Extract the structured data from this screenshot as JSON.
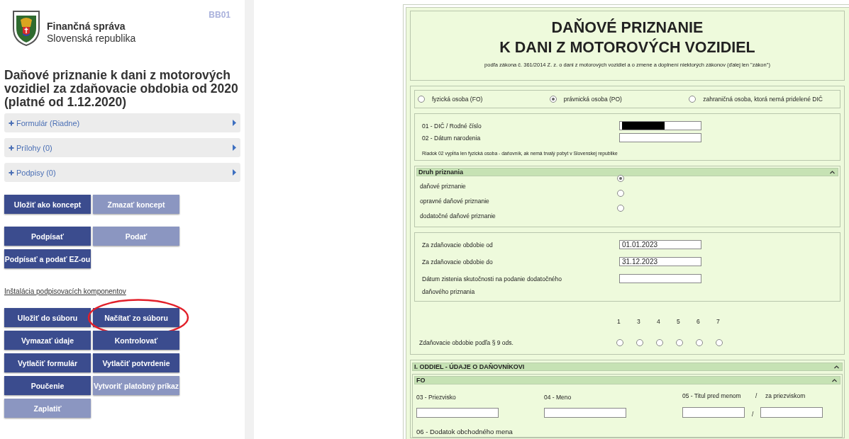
{
  "sidebar": {
    "org_name": "Finančná správa",
    "org_country": "Slovenská republika",
    "code": "BB01",
    "heading": "Daňové priznanie k dani z motorových vozidiel za zdaňovacie obdobia od 2020 (platné od 1.12.2020)",
    "accordions": [
      {
        "label": "Formulár (Riadne)"
      },
      {
        "label": "Prílohy (0)"
      },
      {
        "label": "Podpisy (0)"
      }
    ],
    "button_blocks": [
      {
        "rows": [
          [
            {
              "label": "Uložiť ako koncept",
              "disabled": false,
              "highlighted": false
            },
            {
              "label": "Zmazať koncept",
              "disabled": true,
              "highlighted": false
            }
          ]
        ]
      },
      {
        "rows": [
          [
            {
              "label": "Podpísať",
              "disabled": false,
              "highlighted": false
            },
            {
              "label": "Podať",
              "disabled": true,
              "highlighted": false
            }
          ],
          [
            {
              "label": "Podpísať a podať EZ-ou",
              "disabled": false,
              "highlighted": false
            }
          ]
        ]
      },
      {
        "link": "Inštalácia podpisovacích komponentov"
      },
      {
        "rows": [
          [
            {
              "label": "Uložiť do súboru",
              "disabled": false,
              "highlighted": false
            },
            {
              "label": "Načítať zo súboru",
              "disabled": false,
              "highlighted": true
            }
          ],
          [
            {
              "label": "Vymazať údaje",
              "disabled": false,
              "highlighted": false
            },
            {
              "label": "Kontrolovať",
              "disabled": false,
              "highlighted": false
            }
          ],
          [
            {
              "label": "Vytlačiť formulár",
              "disabled": false,
              "highlighted": false
            },
            {
              "label": "Vytlačiť potvrdenie",
              "disabled": false,
              "highlighted": false
            }
          ],
          [
            {
              "label": "Poučenie",
              "disabled": false,
              "highlighted": false
            },
            {
              "label": "Vytvoriť platobný príkaz",
              "disabled": true,
              "highlighted": false
            }
          ],
          [
            {
              "label": "Zaplatiť",
              "disabled": true,
              "highlighted": false
            }
          ]
        ]
      }
    ]
  },
  "form": {
    "title_lines": [
      "DAŇOVÉ PRIZNANIE",
      "K DANI Z MOTOROVÝCH VOZIDIEL"
    ],
    "subtitle": "podľa zákona č. 361/2014 Z. z. o dani z motorových vozidiel a o zmene a doplnení niektorých zákonov (ďalej len \"zákon\")",
    "person_types": [
      {
        "label": "fyzická osoba (FO)",
        "selected": false
      },
      {
        "label": "právnická osoba (PO)",
        "selected": true
      },
      {
        "label": "zahraničná osoba, ktorá nemá pridelené DIČ",
        "selected": false
      }
    ],
    "id_fields": [
      {
        "label": "01 - DIČ / Rodné číslo",
        "redacted": true
      },
      {
        "label": "02 - Dátum narodenia",
        "redacted": false
      }
    ],
    "note": "Riadok 02 vypĺňa len fyzická osoba - daňovník, ak nemá trvalý pobyt v Slovenskej republike",
    "return_type": {
      "title": "Druh priznania",
      "options": [
        {
          "label": "daňové priznanie",
          "selected": true
        },
        {
          "label": "opravné daňové priznanie",
          "selected": false
        },
        {
          "label": "dodatočné daňové priznanie",
          "selected": false
        }
      ]
    },
    "period_fields": [
      {
        "label": "Za zdaňovacie obdobie od",
        "value": "01.01.2023"
      },
      {
        "label": "Za zdaňovacie obdobie do",
        "value": "31.12.2023"
      },
      {
        "label": "Dátum zistenia skutočnosti na podanie dodatočného daňového priznania"
      }
    ],
    "paragraph9": {
      "label": "Zdaňovacie obdobie podľa § 9 ods.",
      "options": [
        {
          "label": "1",
          "selected": false
        },
        {
          "label": "3",
          "selected": false
        },
        {
          "label": "4",
          "selected": false
        },
        {
          "label": "5",
          "selected": false
        },
        {
          "label": "6",
          "selected": false
        },
        {
          "label": "7",
          "selected": false
        }
      ]
    },
    "section1": {
      "title": "I. ODDIEL - ÚDAJE O DAŇOVNÍKOVI",
      "subsection": "FO",
      "surname_label": "03 - Priezvisko",
      "name_label": "04 - Meno",
      "title_before_label": "05 - Titul pred menom",
      "separator": "/",
      "title_after_label": "za priezviskom",
      "next_label": "06 - Dodatok obchodného mena"
    }
  }
}
